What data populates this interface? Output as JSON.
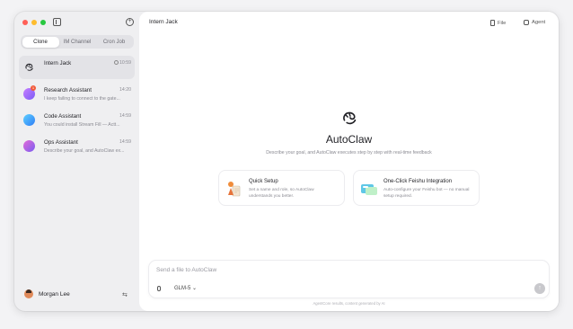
{
  "window": {
    "colors": {
      "red": "#ff5f57",
      "yellow": "#febc2e",
      "green": "#28c840"
    }
  },
  "sidebar": {
    "new_chat_glyph": "+",
    "tabs": [
      {
        "label": "Clone"
      },
      {
        "label": "IM Channel"
      },
      {
        "label": "Cron Job"
      }
    ],
    "chats": [
      {
        "title": "Intern Jack",
        "time": "10:59",
        "subtitle": "",
        "avatar": "claw-icon"
      },
      {
        "title": "Research Assistant",
        "time": "14:20",
        "subtitle": "I keep failing to connect to the gate...",
        "avatar_color": "#9b6bf2",
        "badge": "1"
      },
      {
        "title": "Code Assistant",
        "time": "14:59",
        "subtitle": "You could install Stream Fill — Actt...",
        "avatar_color": "#3aa0ff"
      },
      {
        "title": "Ops Assistant",
        "time": "14:59",
        "subtitle": "Describe your goal, and AutoClaw ex...",
        "avatar_color": "#c55bd6"
      }
    ],
    "user": {
      "name": "Morgan Lee",
      "switch_glyph": "⇆"
    }
  },
  "main": {
    "title": "Intern Jack",
    "file_label": "File",
    "agent_label": "Agent",
    "hero": {
      "title": "AutoClaw",
      "subtitle": "Describe your goal, and AutoClaw executes step by step with real-time feedback"
    },
    "cards": [
      {
        "title": "Quick Setup",
        "desc": "Set a name and role, so AutoClaw understands you better."
      },
      {
        "title": "One-Click Feishu Integration",
        "desc": "Auto-configure your Feishu bot — no manual setup required."
      }
    ],
    "input": {
      "placeholder": "Send a file to AutoClaw",
      "model": "GLM-5",
      "chevron": "⌄",
      "send_glyph": "↑"
    },
    "disclaimer": "AgentCore results, content generated by AI"
  }
}
